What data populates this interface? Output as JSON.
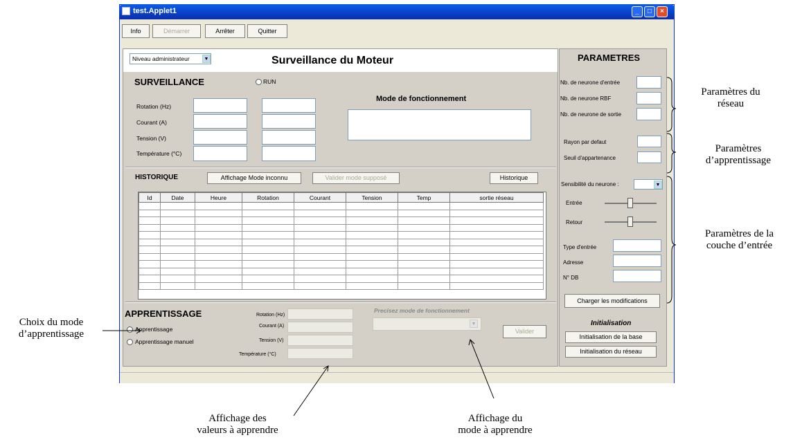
{
  "window": {
    "title": "test.Applet1"
  },
  "toolbar": {
    "info": "Info",
    "demarrer": "Démarrer",
    "arreter": "Arrêter",
    "quitter": "Quitter"
  },
  "header": {
    "level_select": "Niveau administrateur",
    "title": "Surveillance du Moteur"
  },
  "surveillance": {
    "title": "SURVEILLANCE",
    "run_label": "RUN",
    "mode_title": "Mode de fonctionnement",
    "rows": [
      "Rotation (Hz)",
      "Courant (A)",
      "Tension (V)",
      "Température (°C)"
    ]
  },
  "historique": {
    "title": "HISTORIQUE",
    "btn_affichage": "Affichage Mode inconnu",
    "btn_valider": "Valider mode supposé",
    "btn_historique": "Historique",
    "columns": [
      "Id",
      "Date",
      "Heure",
      "Rotation",
      "Courant",
      "Tension",
      "Temp",
      "sortie réseau"
    ]
  },
  "apprentissage": {
    "title": "APPRENTISSAGE",
    "options": [
      "Apprentissage",
      "Apprentissage manuel"
    ],
    "fields": [
      "Rotation (Hz)",
      "Courant (A)",
      "Tension (V)",
      "Température (°C)"
    ],
    "mode_label": "Precisez mode de fonctionnement",
    "valider": "Valider"
  },
  "parametres": {
    "title": "PARAMETRES",
    "reseau": [
      "Nb. de neurone d'entrée",
      "Nb. de neurone RBF",
      "Nb. de neurone de sortie"
    ],
    "apprent": [
      "Rayon par defaut",
      "Seuil d'appartenance"
    ],
    "sensibilite": "Sensibilité du neurone :",
    "entree": "Entrée",
    "retour": "Retour",
    "couche": [
      "Type d'entrée",
      "Adresse",
      "N° DB"
    ],
    "charger": "Charger les modifications",
    "init_title": "Initialisation",
    "init_base": "Initialisation de la base",
    "init_reseau": "Initialisation du réseau"
  },
  "annotations": {
    "params_reseau": [
      "Paramètres du",
      "réseau"
    ],
    "params_apprent": [
      "Paramètres",
      "d’apprentissage"
    ],
    "params_couche": [
      "Paramètres de la",
      "couche d’entrée"
    ],
    "choix_mode": [
      "Choix du mode",
      "d’apprentissage"
    ],
    "affichage_valeurs": [
      "Affichage des",
      "valeurs à apprendre"
    ],
    "affichage_mode": [
      "Affichage du",
      "mode à apprendre"
    ]
  }
}
